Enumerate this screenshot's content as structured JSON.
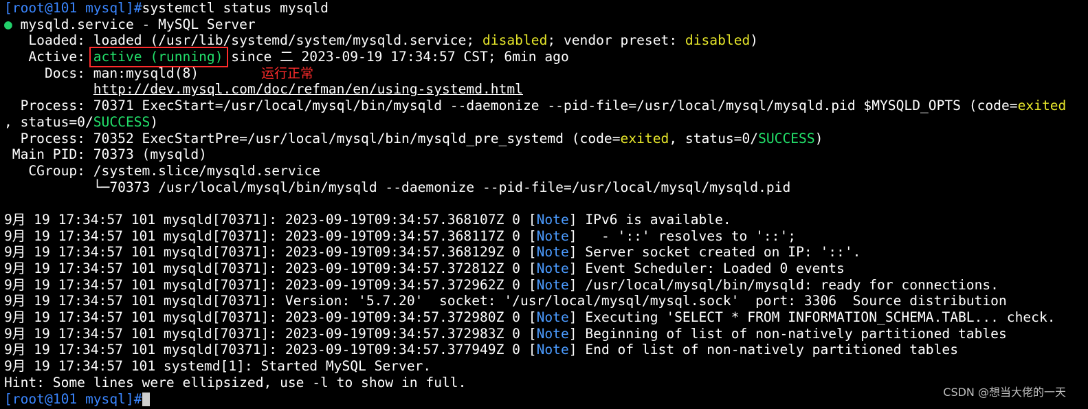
{
  "terminal": {
    "prompt": "[root@101 mysql]#",
    "command": "systemctl status mysqld",
    "bullet": "●",
    "service_line": "mysqld.service - MySQL Server",
    "loaded": {
      "label": "   Loaded: ",
      "pre": "loaded (/usr/lib/systemd/system/mysqld.service; ",
      "state": "disabled",
      "mid": "; vendor preset: ",
      "preset": "disabled",
      "post": ")"
    },
    "active": {
      "label": "   Active: ",
      "status": "active (running)",
      "post": " since 二 2023-09-19 17:34:57 CST; 6min ago"
    },
    "docs": {
      "label": "     Docs: ",
      "value1": "man:mysqld(8)",
      "indent": "           ",
      "value2": "http://dev.mysql.com/doc/refman/en/using-systemd.html"
    },
    "process1": {
      "pre": "  Process: 70371 ExecStart=/usr/local/mysql/bin/mysqld --daemonize --pid-file=/usr/local/mysql/mysqld.pid $MYSQLD_OPTS (code=",
      "code": "exited",
      "wrap_pre": ", status=0/",
      "status": "SUCCESS",
      "wrap_post": ")"
    },
    "process2": {
      "pre": "  Process: 70352 ExecStartPre=/usr/local/mysql/bin/mysqld_pre_systemd (code=",
      "code": "exited",
      "mid": ", status=0/",
      "status": "SUCCESS",
      "post": ")"
    },
    "main_pid": " Main PID: 70373 (mysqld)",
    "cgroup": "   CGroup: /system.slice/mysqld.service",
    "cgroup_child": "           └─70373 /usr/local/mysql/bin/mysqld --daemonize --pid-file=/usr/local/mysql/mysqld.pid",
    "logs": [
      {
        "pre": "9月 19 17:34:57 101 mysqld[70371]: 2023-09-19T09:34:57.368107Z 0 [",
        "tag": "Note",
        "post": "] IPv6 is available."
      },
      {
        "pre": "9月 19 17:34:57 101 mysqld[70371]: 2023-09-19T09:34:57.368117Z 0 [",
        "tag": "Note",
        "post": "]   - '::' resolves to '::';"
      },
      {
        "pre": "9月 19 17:34:57 101 mysqld[70371]: 2023-09-19T09:34:57.368129Z 0 [",
        "tag": "Note",
        "post": "] Server socket created on IP: '::'."
      },
      {
        "pre": "9月 19 17:34:57 101 mysqld[70371]: 2023-09-19T09:34:57.372812Z 0 [",
        "tag": "Note",
        "post": "] Event Scheduler: Loaded 0 events"
      },
      {
        "pre": "9月 19 17:34:57 101 mysqld[70371]: 2023-09-19T09:34:57.372962Z 0 [",
        "tag": "Note",
        "post": "] /usr/local/mysql/bin/mysqld: ready for connections."
      },
      {
        "pre": "9月 19 17:34:57 101 mysqld[70371]: Version: '5.7.20'  socket: '/usr/local/mysql/mysql.sock'  port: 3306  Source distribution",
        "tag": "",
        "post": ""
      },
      {
        "pre": "9月 19 17:34:57 101 mysqld[70371]: 2023-09-19T09:34:57.372980Z 0 [",
        "tag": "Note",
        "post": "] Executing 'SELECT * FROM INFORMATION_SCHEMA.TABL... check."
      },
      {
        "pre": "9月 19 17:34:57 101 mysqld[70371]: 2023-09-19T09:34:57.372983Z 0 [",
        "tag": "Note",
        "post": "] Beginning of list of non-natively partitioned tables"
      },
      {
        "pre": "9月 19 17:34:57 101 mysqld[70371]: 2023-09-19T09:34:57.377949Z 0 [",
        "tag": "Note",
        "post": "] End of list of non-natively partitioned tables"
      },
      {
        "pre": "9月 19 17:34:57 101 systemd[1]: Started MySQL Server.",
        "tag": "",
        "post": ""
      }
    ],
    "hint": "Hint: Some lines were ellipsized, use -l to show in full."
  },
  "annotation": "运行正常",
  "watermark": "CSDN @想当大佬的一天",
  "colors": {
    "background": "#000000",
    "prompt": "#3a86ff",
    "yellow": "#e6e62a",
    "green": "#22e06a",
    "note_blue": "#4b9bff",
    "annotation_red": "#ff2b2b"
  }
}
